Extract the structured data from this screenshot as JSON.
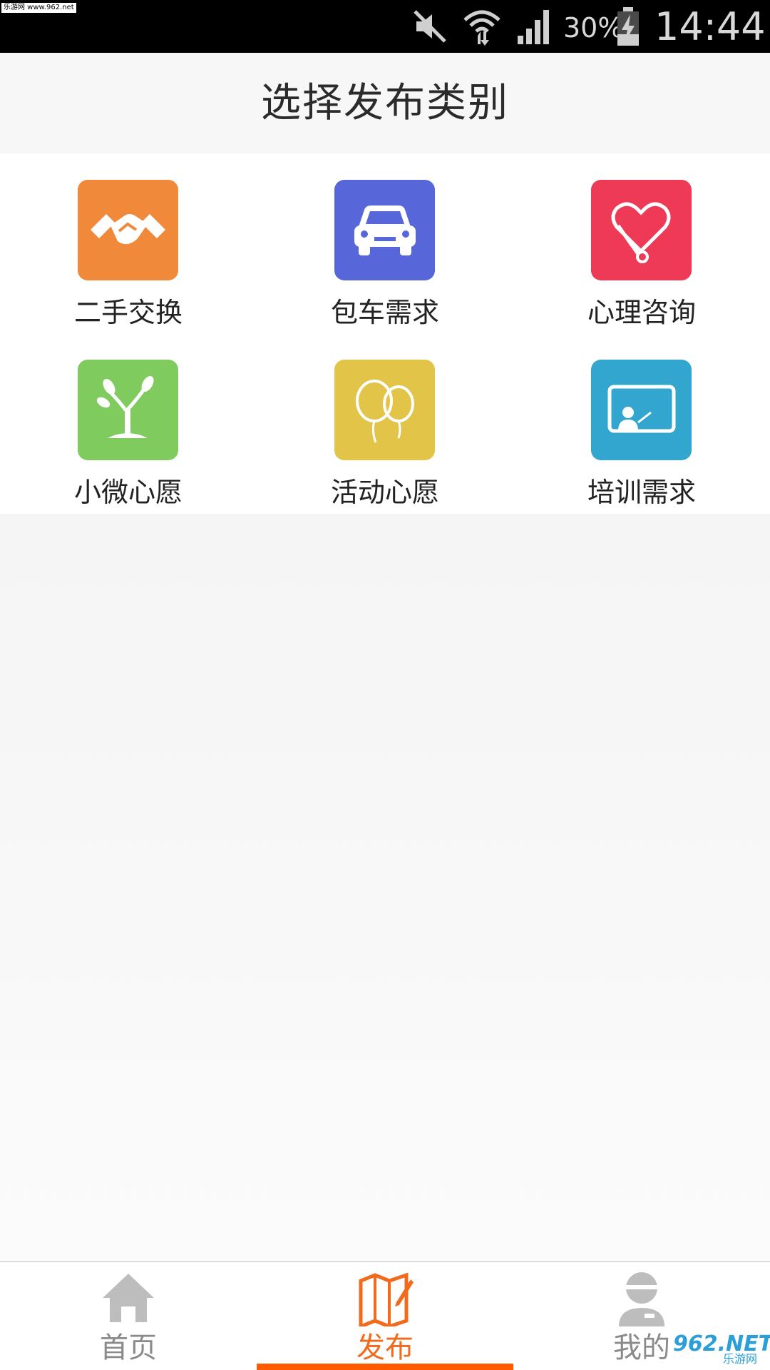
{
  "status_bar": {
    "watermark": "乐游网 www.962.net",
    "battery_percent": "30%",
    "time": "14:44",
    "icons": [
      "mute-icon",
      "wifi-icon",
      "signal-icon",
      "battery-charging-icon"
    ]
  },
  "header": {
    "title": "选择发布类别"
  },
  "categories": [
    {
      "label": "二手交换",
      "icon": "handshake-icon",
      "color": "#f08a3a"
    },
    {
      "label": "包车需求",
      "icon": "car-icon",
      "color": "#5766d9"
    },
    {
      "label": "心理咨询",
      "icon": "heart-stethoscope-icon",
      "color": "#ee3a56"
    },
    {
      "label": "小微心愿",
      "icon": "sprout-icon",
      "color": "#7fcb5e"
    },
    {
      "label": "活动心愿",
      "icon": "balloons-icon",
      "color": "#e2c448"
    },
    {
      "label": "培训需求",
      "icon": "blackboard-teacher-icon",
      "color": "#33a6cf"
    }
  ],
  "bottom_nav": {
    "items": [
      {
        "label": "首页",
        "icon": "home-icon",
        "active": false
      },
      {
        "label": "发布",
        "icon": "publish-map-pencil-icon",
        "active": true
      },
      {
        "label": "我的",
        "icon": "user-icon",
        "active": false
      }
    ],
    "active_color": "#ff5a00",
    "inactive_color": "#8a8a8a"
  },
  "watermark_bottom": {
    "main": "962.NET",
    "sub": "乐游网"
  }
}
